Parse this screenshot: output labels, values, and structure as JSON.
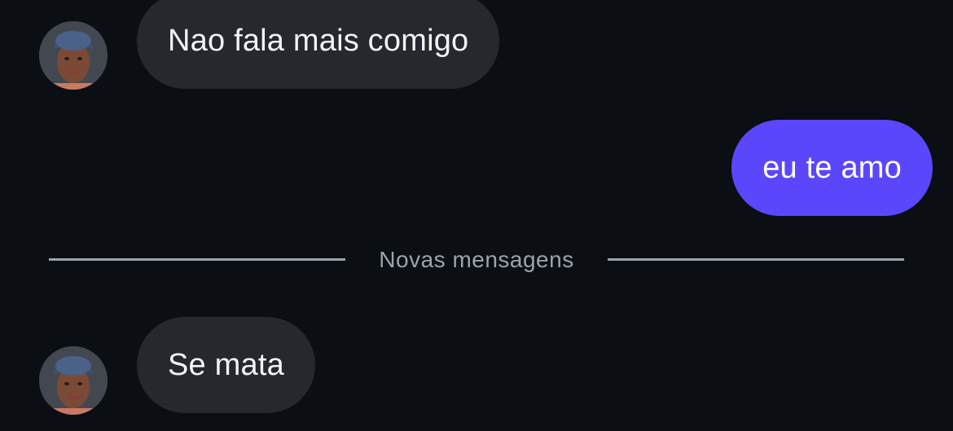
{
  "messages": [
    {
      "direction": "incoming",
      "text": "Nao fala mais comigo"
    },
    {
      "direction": "outgoing",
      "text": "eu te amo"
    },
    {
      "direction": "incoming",
      "text": "Se mata"
    }
  ],
  "divider": {
    "label": "Novas mensagens"
  },
  "colors": {
    "background": "#0b0e13",
    "incoming_bubble": "#26282d",
    "outgoing_bubble": "#5b47fb",
    "divider": "#9ca3ab"
  },
  "icons": {
    "avatar": "contact-photo"
  }
}
